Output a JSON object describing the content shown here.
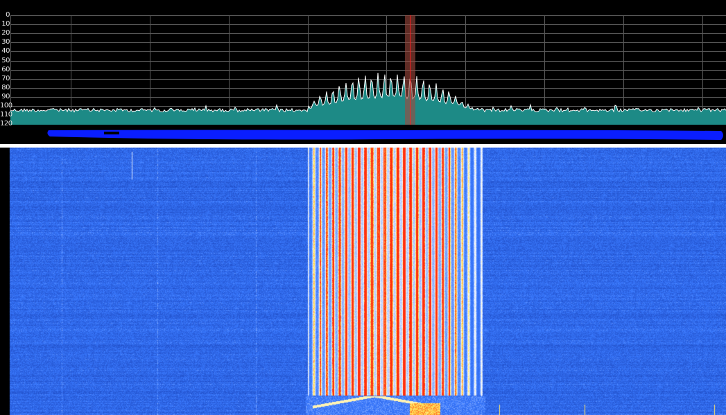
{
  "spectrum": {
    "db_scale_labels": [
      "0",
      "10",
      "20",
      "30",
      "40",
      "50",
      "60",
      "70",
      "80",
      "90",
      "100",
      "110",
      "120"
    ],
    "colors": {
      "background": "#000000",
      "grid": "#5a5a5a",
      "fill": "#1d8a86",
      "trace": "#ffffff",
      "marker_band": "#9e4a3e",
      "marker_line": "#ff2020",
      "scale_bar": "#0a1eff"
    }
  },
  "waterfall": {
    "colors": {
      "low": "#0b2a9a",
      "mid": "#3a7aff",
      "high": "#ffffff",
      "peak_yellow": "#ffe14a",
      "peak_red": "#ff3010"
    }
  }
}
